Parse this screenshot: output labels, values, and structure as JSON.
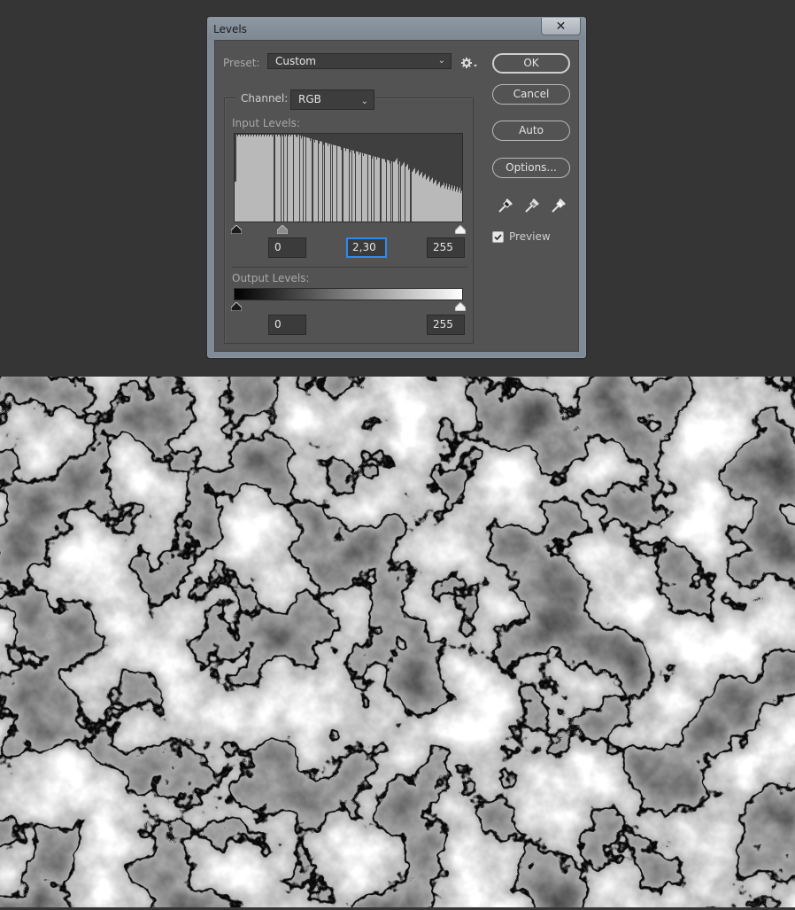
{
  "dialog": {
    "title": "Levels",
    "close_glyph": "✕"
  },
  "preset": {
    "label": "Preset:",
    "value": "Custom",
    "settings_icon": "gear-icon"
  },
  "channel": {
    "label": "Channel:",
    "value": "RGB"
  },
  "input_levels": {
    "label": "Input Levels:",
    "black": "0",
    "gamma": "2,30",
    "white": "255"
  },
  "output_levels": {
    "label": "Output Levels:",
    "black": "0",
    "white": "255"
  },
  "buttons": {
    "ok": "OK",
    "cancel": "Cancel",
    "auto": "Auto",
    "options": "Options..."
  },
  "eyedroppers": [
    "black-point-eyedropper-icon",
    "gray-point-eyedropper-icon",
    "white-point-eyedropper-icon"
  ],
  "preview": {
    "label": "Preview",
    "checked": true
  },
  "colors": {
    "dialog_bg": "#535353",
    "workspace_bg": "#353535",
    "focus_accent": "#2d8ceb",
    "histogram_bars": "#b9b9b9"
  }
}
